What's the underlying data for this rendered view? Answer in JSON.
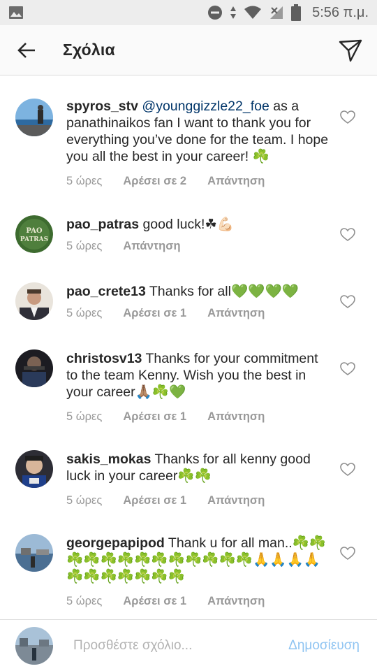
{
  "status_bar": {
    "time": "5:56 π.μ."
  },
  "header": {
    "title": "Σχόλια"
  },
  "comments": [
    {
      "username": "spyros_stv",
      "mention": "@younggizzle22_foe",
      "text": " as a panathinaikos fan I want to thank you for everything you’ve done for the team. I hope you all the best in your career! ☘️",
      "time": "5 ώρες",
      "likes": "Αρέσει σε 2",
      "reply": "Απάντηση"
    },
    {
      "username": "pao_patras",
      "mention": "",
      "text": " good luck!☘💪🏻",
      "time": "5 ώρες",
      "likes": "",
      "reply": "Απάντηση",
      "avatar_text": "PAO PATRAS"
    },
    {
      "username": "pao_crete13",
      "mention": "",
      "text": " Thanks for all💚💚💚💚",
      "time": "5 ώρες",
      "likes": "Αρέσει σε 1",
      "reply": "Απάντηση"
    },
    {
      "username": "christosv13",
      "mention": "",
      "text": " Thanks for your commitment to the team Kenny. Wish you the best in your career🙏🏽☘️💚",
      "time": "5 ώρες",
      "likes": "Αρέσει σε 1",
      "reply": "Απάντηση"
    },
    {
      "username": "sakis_mokas",
      "mention": "",
      "text": " Thanks for all kenny good luck  in your career☘️☘️",
      "time": "5 ώρες",
      "likes": "Αρέσει σε 1",
      "reply": "Απάντηση"
    },
    {
      "username": "georgepapipod",
      "mention": "",
      "text": " Thank u for all man..☘️☘️☘️☘️☘️☘️☘️☘️☘️☘️☘️☘️☘️🙏🙏🙏🙏☘️☘️☘️☘️☘️☘️☘️",
      "time": "5 ώρες",
      "likes": "Αρέσει σε 1",
      "reply": "Απάντηση"
    }
  ],
  "composer": {
    "placeholder": "Προσθέστε σχόλιο...",
    "post_label": "Δημοσίευση"
  },
  "icons": {
    "back": "arrow-left-icon",
    "direct": "paper-plane-icon",
    "like": "heart-outline-icon"
  },
  "colors": {
    "mention": "#003569",
    "post_button": "#8fc4f2",
    "meta_text": "#999999",
    "clover": "#3aa335",
    "green_heart": "#61c33a"
  }
}
